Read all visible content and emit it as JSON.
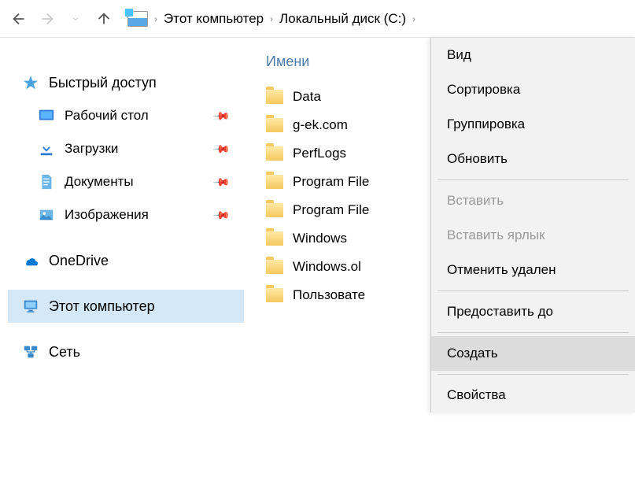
{
  "breadcrumb": {
    "items": [
      "Этот компьютер",
      "Локальный диск (C:)"
    ]
  },
  "sidebar": {
    "quickAccess": "Быстрый доступ",
    "desktop": "Рабочий стол",
    "downloads": "Загрузки",
    "documents": "Документы",
    "pictures": "Изображения",
    "onedrive": "OneDrive",
    "thisPc": "Этот компьютер",
    "network": "Сеть"
  },
  "content": {
    "columnHeader": "Имени",
    "folders": [
      "Data",
      "g-ek.com",
      "PerfLogs",
      "Program File",
      "Program File",
      "Windows",
      "Windows.ol",
      "Пользовате"
    ]
  },
  "contextMenu": {
    "view": "Вид",
    "sort": "Сортировка",
    "group": "Группировка",
    "refresh": "Обновить",
    "paste": "Вставить",
    "pasteShortcut": "Вставить ярлык",
    "undoDelete": "Отменить удален",
    "giveAccess": "Предоставить до",
    "create": "Создать",
    "properties": "Свойства"
  }
}
